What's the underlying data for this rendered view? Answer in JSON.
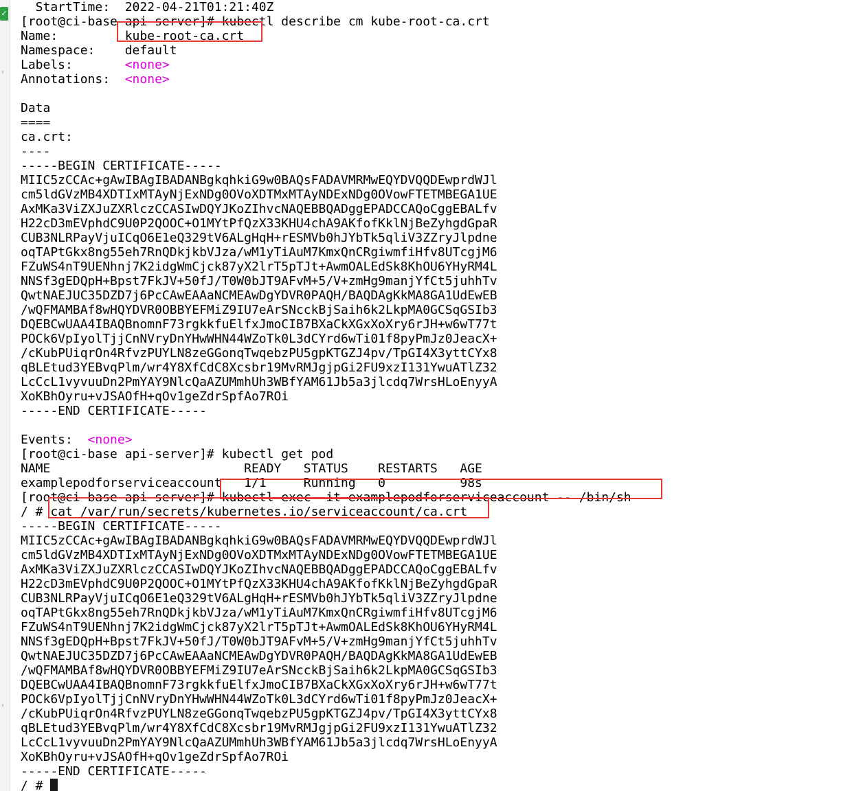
{
  "colors": {
    "highlight": "#e53935",
    "none_tag": "#e000e0",
    "status_ok": "#2ea043"
  },
  "gutter": {
    "status_icon": "check-circle-icon",
    "status_glyph": "✓",
    "fold_glyph": "›"
  },
  "terminal": {
    "top_partial": "  StartTime:  2022-04-21T01:21:40Z",
    "prompt": "[root@ci-base api-server]# ",
    "shell_prompt": "/ # ",
    "describe_cmd": "kubectl describe cm kube-root-ca.crt",
    "fields": [
      {
        "key": "Name:         ",
        "value": "kube-root-ca.crt"
      },
      {
        "key": "Namespace:    ",
        "value": "default"
      },
      {
        "key": "Labels:       ",
        "value": "<none>"
      },
      {
        "key": "Annotations:  ",
        "value": "<none>"
      }
    ],
    "data_label": "Data",
    "data_underline": "====",
    "ca_key": "ca.crt:",
    "ca_sep": "----",
    "cert_begin": "-----BEGIN CERTIFICATE-----",
    "cert_end": "-----END CERTIFICATE-----",
    "cert_lines": [
      "MIIC5zCCAc+gAwIBAgIBADANBgkqhkiG9w0BAQsFADAVMRMwEQYDVQQDEwprdWJl",
      "cm5ldGVzMB4XDTIxMTAyNjExNDg0OVoXDTMxMTAyNDExNDg0OVowFTETMBEGA1UE",
      "AxMKa3ViZXJuZXRlczCCASIwDQYJKoZIhvcNAQEBBQADggEPADCCAQoCggEBALfv",
      "H22cD3mEVphdC9U0P2QOOC+O1MYtPfQzX33KHU4chA9AKfofKklNjBeZyhgdGpaR",
      "CUB3NLRPayVjuICqO6E1eQ329tV6ALgHqH+rESMVb0hJYbTk5qliV3ZZryJlpdne",
      "oqTAPtGkx8ng55eh7RnQDkjkbVJza/wM1yTiAuM7KmxQnCRgiwmfiHfv8UTcgjM6",
      "FZuWS4nT9UENhnj7K2idgWmCjck87yX2lrT5pTJt+AwmOALEdSk8KhOU6YHyRM4L",
      "NNSf3gEDQpH+Bpst7FkJV+50fJ/T0W0bJT9AFvM+5/V+zmHg9manjYfCt5juhhTv",
      "QwtNAEJUC35DZD7j6PcCAwEAAaNCMEAwDgYDVR0PAQH/BAQDAgKkMA8GA1UdEwEB",
      "/wQFMAMBAf8wHQYDVR0OBBYEFMiZ9IU7eArSNcckBjSaih6k2LkpMA0GCSqGSIb3",
      "DQEBCwUAA4IBAQBnomnF73rgkkfuElfxJmoCIB7BXaCkXGxXoXry6rJH+w6wT77t",
      "POCk6VpIyolTjjCnNVryDnYHwWHN44WZoTk0L3dCYrd6wTi01f8pyPmJz0JeacX+",
      "/cKubPUiqrOn4RfvzPUYLN8zeGGonqTwqebzPU5gpKTGZJ4pv/TpGI4X3yttCYx8",
      "qBLEtud3YEBvqPlm/wr4Y8XfCdC8Xcsbr19MvRMJgjpGi2FU9xzI131YwuATlZ32",
      "LcCcL1vyvuuDn2PmYAY9NlcQaAZUMmhUh3WBfYAM61Jb5a3jlcdq7WrsHLoEnyyA",
      "XoKBhOyru+vJSAOfH+qOv1geZdrSpfAo7ROi"
    ],
    "events_key": "Events:  ",
    "none_tag": "<none>",
    "get_cmd": "kubectl get pod",
    "pod_header": "NAME                          READY   STATUS    RESTARTS   AGE",
    "pod_row": "examplepodforserviceaccount   1/1     Running   0          98s",
    "exec_cmd": "kubectl exec -it examplepodforserviceaccount -- /bin/sh",
    "cat_cmd": "cat /var/run/secrets/kubernetes.io/serviceaccount/ca.crt"
  }
}
